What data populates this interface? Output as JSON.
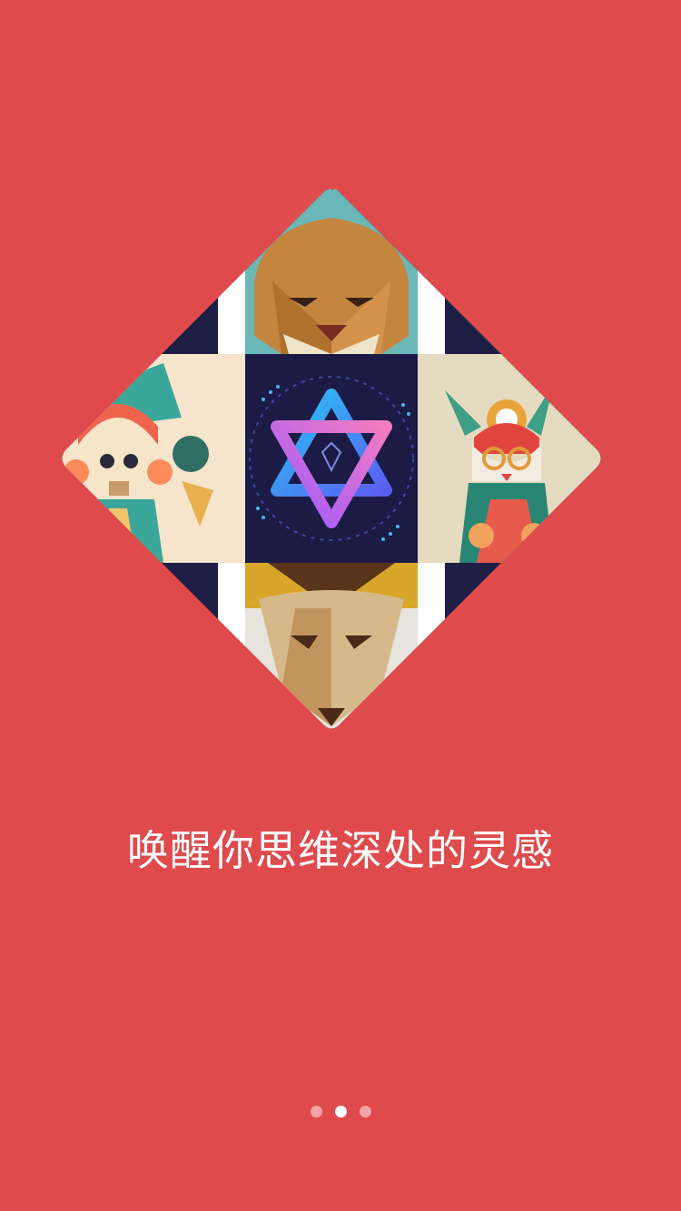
{
  "colors": {
    "background": "#df4a4c",
    "text": "#ffffff",
    "dot_active": "#ffffff",
    "dot_inactive": "#f2a4a5"
  },
  "onboarding": {
    "tagline": "唤醒你思维深处的灵感",
    "illustrations": [
      {
        "name": "lion",
        "icon": "lion-face-illustration"
      },
      {
        "name": "girl",
        "icon": "girl-character-illustration"
      },
      {
        "name": "star",
        "icon": "neon-hexagram-logo"
      },
      {
        "name": "rabbit",
        "icon": "rabbit-character-illustration"
      },
      {
        "name": "fox",
        "icon": "fox-face-illustration"
      }
    ]
  },
  "pager": {
    "pages": 3,
    "active_index": 1
  }
}
